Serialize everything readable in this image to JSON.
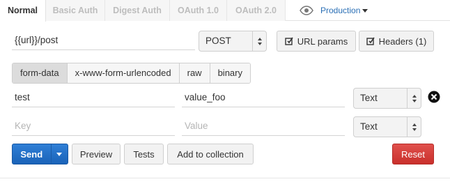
{
  "tabs": [
    {
      "label": "Normal",
      "active": true
    },
    {
      "label": "Basic Auth",
      "active": false
    },
    {
      "label": "Digest Auth",
      "active": false
    },
    {
      "label": "OAuth 1.0",
      "active": false
    },
    {
      "label": "OAuth 2.0",
      "active": false
    }
  ],
  "environment": {
    "label": "Production",
    "icon": "eye-icon"
  },
  "request": {
    "url": "{{url}}/post",
    "method": "POST",
    "url_params_label": "URL params",
    "headers_label": "Headers (1)"
  },
  "body_types": [
    {
      "label": "form-data",
      "active": true
    },
    {
      "label": "x-www-form-urlencoded",
      "active": false
    },
    {
      "label": "raw",
      "active": false
    },
    {
      "label": "binary",
      "active": false
    }
  ],
  "params": [
    {
      "key": "test",
      "value": "value_foo",
      "type": "Text"
    },
    {
      "key": "",
      "value": "",
      "type": "Text",
      "key_placeholder": "Key",
      "value_placeholder": "Value"
    }
  ],
  "actions": {
    "send": "Send",
    "preview": "Preview",
    "tests": "Tests",
    "add_to_collection": "Add to collection",
    "reset": "Reset"
  },
  "colors": {
    "primary": "#1a63b8",
    "danger": "#c9302c",
    "link": "#2a6fb5"
  }
}
